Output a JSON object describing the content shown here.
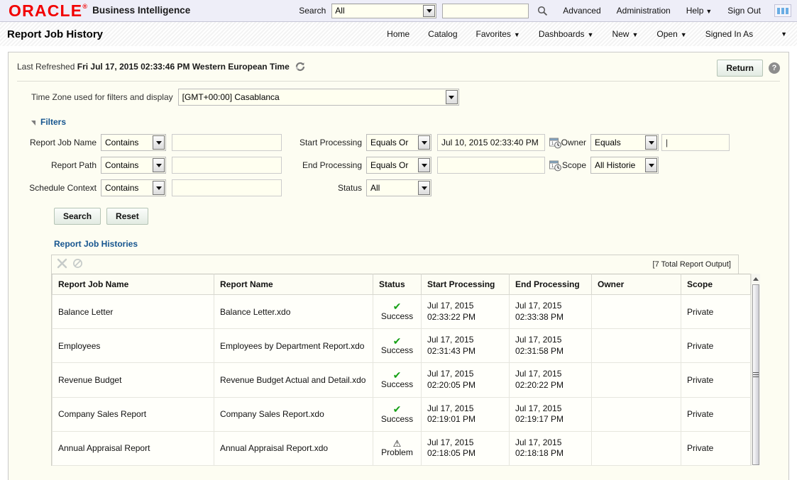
{
  "header": {
    "brand": "ORACLE",
    "brand_reg": "®",
    "product": "Business Intelligence",
    "search_label": "Search",
    "search_scope_value": "All",
    "search_input_value": "",
    "search_icon": "search-icon",
    "links": [
      {
        "label": "Advanced",
        "has_caret": false
      },
      {
        "label": "Administration",
        "has_caret": false
      },
      {
        "label": "Help",
        "has_caret": true
      },
      {
        "label": "Sign Out",
        "has_caret": false
      }
    ],
    "grid_button_icon": "app-grid-icon",
    "accent_color": "#f20000",
    "background_color": "#eeeef8"
  },
  "titlebar": {
    "title": "Report Job History",
    "nav": [
      {
        "label": "Home",
        "has_caret": false
      },
      {
        "label": "Catalog",
        "has_caret": false
      },
      {
        "label": "Favorites",
        "has_caret": true
      },
      {
        "label": "Dashboards",
        "has_caret": true
      },
      {
        "label": "New",
        "has_caret": true
      },
      {
        "label": "Open",
        "has_caret": true
      },
      {
        "label": "Signed In As",
        "has_caret": false
      }
    ],
    "trailing_caret": "▼"
  },
  "panel": {
    "last_refreshed_label": "Last Refreshed",
    "last_refreshed_value": "Fri Jul 17, 2015 02:33:46 PM Western European Time",
    "refresh_icon": "refresh-icon",
    "return_button": "Return",
    "help_icon": "help-icon",
    "help_glyph": "?"
  },
  "timezone": {
    "label": "Time Zone used for filters and display",
    "value": "[GMT+00:00] Casablanca"
  },
  "filters": {
    "section_title": "Filters",
    "collapse_icon": "triangle-down-icon",
    "rows": [
      {
        "left_label": "Report Job Name",
        "left_operator": "Contains",
        "left_value": "",
        "mid_label": "Start Processing",
        "mid_operator": "Equals Or",
        "mid_value": "Jul 10, 2015 02:33:40 PM",
        "mid_icon": "calendar-clock-icon",
        "right_label": "Owner",
        "right_operator": "Equals",
        "right_value": ""
      },
      {
        "left_label": "Report Path",
        "left_operator": "Contains",
        "left_value": "",
        "mid_label": "End Processing",
        "mid_operator": "Equals Or",
        "mid_value": "",
        "mid_icon": "calendar-clock-icon",
        "right_label": "Scope",
        "right_operator": "All Historie",
        "right_value": null
      },
      {
        "left_label": "Schedule Context",
        "left_operator": "Contains",
        "left_value": "",
        "mid_label": "Status",
        "mid_operator": "All",
        "mid_value": null,
        "mid_icon": null,
        "right_label": null,
        "right_operator": null,
        "right_value": null
      }
    ],
    "search_button": "Search",
    "reset_button": "Reset"
  },
  "results": {
    "section_title": "Report Job Histories",
    "toolbar_icons": [
      {
        "name": "delete-x-icon",
        "glyph": "✕"
      },
      {
        "name": "cancel-circle-icon",
        "glyph": "⃠"
      }
    ],
    "total_text": "[7 Total Report Output]",
    "columns": [
      "Report Job Name",
      "Report Name",
      "Status",
      "Start Processing",
      "End Processing",
      "Owner",
      "Scope"
    ],
    "rows": [
      {
        "job_name": "Balance Letter",
        "report_name": "Balance Letter.xdo",
        "status": "Success",
        "status_icon": "success-check-icon",
        "start_date": "Jul 17, 2015",
        "start_time": "02:33:22 PM",
        "end_date": "Jul 17, 2015",
        "end_time": "02:33:38 PM",
        "owner": "",
        "scope": "Private"
      },
      {
        "job_name": "Employees",
        "report_name": "Employees by Department Report.xdo",
        "status": "Success",
        "status_icon": "success-check-icon",
        "start_date": "Jul 17, 2015",
        "start_time": "02:31:43 PM",
        "end_date": "Jul 17, 2015",
        "end_time": "02:31:58 PM",
        "owner": "",
        "scope": "Private"
      },
      {
        "job_name": "Revenue Budget",
        "report_name": "Revenue Budget Actual and Detail.xdo",
        "status": "Success",
        "status_icon": "success-check-icon",
        "start_date": "Jul 17, 2015",
        "start_time": "02:20:05 PM",
        "end_date": "Jul 17, 2015",
        "end_time": "02:20:22 PM",
        "owner": "",
        "scope": "Private"
      },
      {
        "job_name": "Company Sales Report",
        "report_name": "Company Sales Report.xdo",
        "status": "Success",
        "status_icon": "success-check-icon",
        "start_date": "Jul 17, 2015",
        "start_time": "02:19:01 PM",
        "end_date": "Jul 17, 2015",
        "end_time": "02:19:17 PM",
        "owner": "",
        "scope": "Private"
      },
      {
        "job_name": "Annual Appraisal Report",
        "report_name": "Annual Appraisal Report.xdo",
        "status": "Problem",
        "status_icon": "warning-problem-icon",
        "start_date": "Jul 17, 2015",
        "start_time": "02:18:05 PM",
        "end_date": "Jul 17, 2015",
        "end_time": "02:18:18 PM",
        "owner": "",
        "scope": "Private"
      }
    ],
    "scrollbar": {
      "up_arrow_icon": "scroll-up-arrow-icon",
      "grip_icon": "scroll-grip-icon"
    }
  }
}
